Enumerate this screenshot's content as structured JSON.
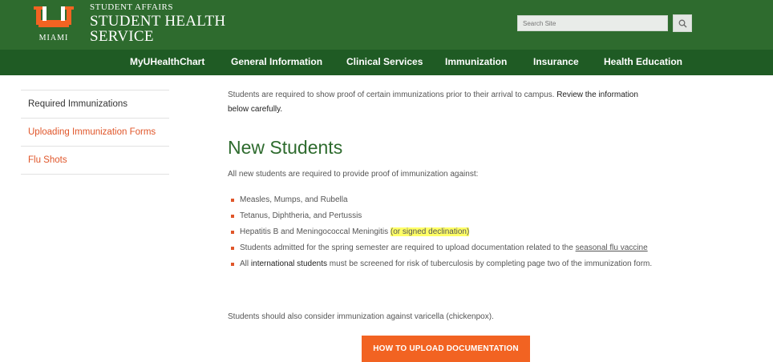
{
  "brand": {
    "logo_word": "MIAMI",
    "subtitle": "STUDENT AFFAIRS",
    "title_line1": "STUDENT HEALTH",
    "title_line2": "SERVICE",
    "colors": {
      "orange": "#f26322",
      "green": "#2e6b2e",
      "dark_green": "#1f5b24"
    }
  },
  "search": {
    "placeholder": "Search Site",
    "button_icon": "search-icon"
  },
  "nav": [
    "MyUHealthChart",
    "General Information",
    "Clinical Services",
    "Immunization",
    "Insurance",
    "Health Education"
  ],
  "sidebar": [
    "Required Immunizations",
    "Uploading Immunization Forms",
    "Flu Shots"
  ],
  "content": {
    "intro_a": "Students are required to show proof of certain immunizations prior to their arrival to campus. ",
    "intro_b": "Review the information below carefully.",
    "heading": "New Students",
    "p1": "All new students are required to provide proof of immunization against:",
    "list": {
      "i1": "Measles, Mumps, and Rubella",
      "i2": "Tetanus, Diphtheria, and Pertussis",
      "i3a": "Hepatitis B and Meningococcal Meningitis ",
      "i3b": "(or signed declination)",
      "i4a": "Students admitted for the spring semester are required to upload documentation related to the ",
      "i4b": "seasonal flu vaccine",
      "i5a": "All ",
      "i5b": "international students",
      "i5c": " must be screened for risk of tuberculosis by completing page two of the immunization form."
    },
    "p2": "Students should also consider immunization against varicella (chickenpox).",
    "cta": "HOW TO UPLOAD DOCUMENTATION"
  }
}
